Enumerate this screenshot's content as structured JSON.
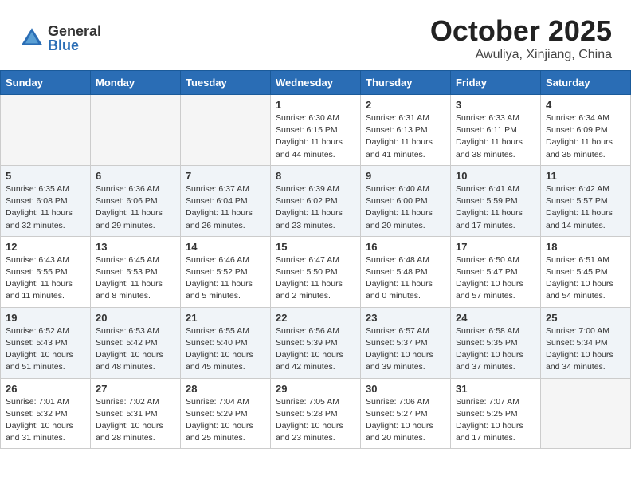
{
  "header": {
    "logo_general": "General",
    "logo_blue": "Blue",
    "title": "October 2025",
    "location": "Awuliya, Xinjiang, China"
  },
  "days_of_week": [
    "Sunday",
    "Monday",
    "Tuesday",
    "Wednesday",
    "Thursday",
    "Friday",
    "Saturday"
  ],
  "weeks": [
    [
      {
        "day": "",
        "empty": true
      },
      {
        "day": "",
        "empty": true
      },
      {
        "day": "",
        "empty": true
      },
      {
        "day": "1",
        "sunrise": "6:30 AM",
        "sunset": "6:15 PM",
        "daylight": "11 hours and 44 minutes."
      },
      {
        "day": "2",
        "sunrise": "6:31 AM",
        "sunset": "6:13 PM",
        "daylight": "11 hours and 41 minutes."
      },
      {
        "day": "3",
        "sunrise": "6:33 AM",
        "sunset": "6:11 PM",
        "daylight": "11 hours and 38 minutes."
      },
      {
        "day": "4",
        "sunrise": "6:34 AM",
        "sunset": "6:09 PM",
        "daylight": "11 hours and 35 minutes."
      }
    ],
    [
      {
        "day": "5",
        "sunrise": "6:35 AM",
        "sunset": "6:08 PM",
        "daylight": "11 hours and 32 minutes."
      },
      {
        "day": "6",
        "sunrise": "6:36 AM",
        "sunset": "6:06 PM",
        "daylight": "11 hours and 29 minutes."
      },
      {
        "day": "7",
        "sunrise": "6:37 AM",
        "sunset": "6:04 PM",
        "daylight": "11 hours and 26 minutes."
      },
      {
        "day": "8",
        "sunrise": "6:39 AM",
        "sunset": "6:02 PM",
        "daylight": "11 hours and 23 minutes."
      },
      {
        "day": "9",
        "sunrise": "6:40 AM",
        "sunset": "6:00 PM",
        "daylight": "11 hours and 20 minutes."
      },
      {
        "day": "10",
        "sunrise": "6:41 AM",
        "sunset": "5:59 PM",
        "daylight": "11 hours and 17 minutes."
      },
      {
        "day": "11",
        "sunrise": "6:42 AM",
        "sunset": "5:57 PM",
        "daylight": "11 hours and 14 minutes."
      }
    ],
    [
      {
        "day": "12",
        "sunrise": "6:43 AM",
        "sunset": "5:55 PM",
        "daylight": "11 hours and 11 minutes."
      },
      {
        "day": "13",
        "sunrise": "6:45 AM",
        "sunset": "5:53 PM",
        "daylight": "11 hours and 8 minutes."
      },
      {
        "day": "14",
        "sunrise": "6:46 AM",
        "sunset": "5:52 PM",
        "daylight": "11 hours and 5 minutes."
      },
      {
        "day": "15",
        "sunrise": "6:47 AM",
        "sunset": "5:50 PM",
        "daylight": "11 hours and 2 minutes."
      },
      {
        "day": "16",
        "sunrise": "6:48 AM",
        "sunset": "5:48 PM",
        "daylight": "11 hours and 0 minutes."
      },
      {
        "day": "17",
        "sunrise": "6:50 AM",
        "sunset": "5:47 PM",
        "daylight": "10 hours and 57 minutes."
      },
      {
        "day": "18",
        "sunrise": "6:51 AM",
        "sunset": "5:45 PM",
        "daylight": "10 hours and 54 minutes."
      }
    ],
    [
      {
        "day": "19",
        "sunrise": "6:52 AM",
        "sunset": "5:43 PM",
        "daylight": "10 hours and 51 minutes."
      },
      {
        "day": "20",
        "sunrise": "6:53 AM",
        "sunset": "5:42 PM",
        "daylight": "10 hours and 48 minutes."
      },
      {
        "day": "21",
        "sunrise": "6:55 AM",
        "sunset": "5:40 PM",
        "daylight": "10 hours and 45 minutes."
      },
      {
        "day": "22",
        "sunrise": "6:56 AM",
        "sunset": "5:39 PM",
        "daylight": "10 hours and 42 minutes."
      },
      {
        "day": "23",
        "sunrise": "6:57 AM",
        "sunset": "5:37 PM",
        "daylight": "10 hours and 39 minutes."
      },
      {
        "day": "24",
        "sunrise": "6:58 AM",
        "sunset": "5:35 PM",
        "daylight": "10 hours and 37 minutes."
      },
      {
        "day": "25",
        "sunrise": "7:00 AM",
        "sunset": "5:34 PM",
        "daylight": "10 hours and 34 minutes."
      }
    ],
    [
      {
        "day": "26",
        "sunrise": "7:01 AM",
        "sunset": "5:32 PM",
        "daylight": "10 hours and 31 minutes."
      },
      {
        "day": "27",
        "sunrise": "7:02 AM",
        "sunset": "5:31 PM",
        "daylight": "10 hours and 28 minutes."
      },
      {
        "day": "28",
        "sunrise": "7:04 AM",
        "sunset": "5:29 PM",
        "daylight": "10 hours and 25 minutes."
      },
      {
        "day": "29",
        "sunrise": "7:05 AM",
        "sunset": "5:28 PM",
        "daylight": "10 hours and 23 minutes."
      },
      {
        "day": "30",
        "sunrise": "7:06 AM",
        "sunset": "5:27 PM",
        "daylight": "10 hours and 20 minutes."
      },
      {
        "day": "31",
        "sunrise": "7:07 AM",
        "sunset": "5:25 PM",
        "daylight": "10 hours and 17 minutes."
      },
      {
        "day": "",
        "empty": true
      }
    ]
  ]
}
